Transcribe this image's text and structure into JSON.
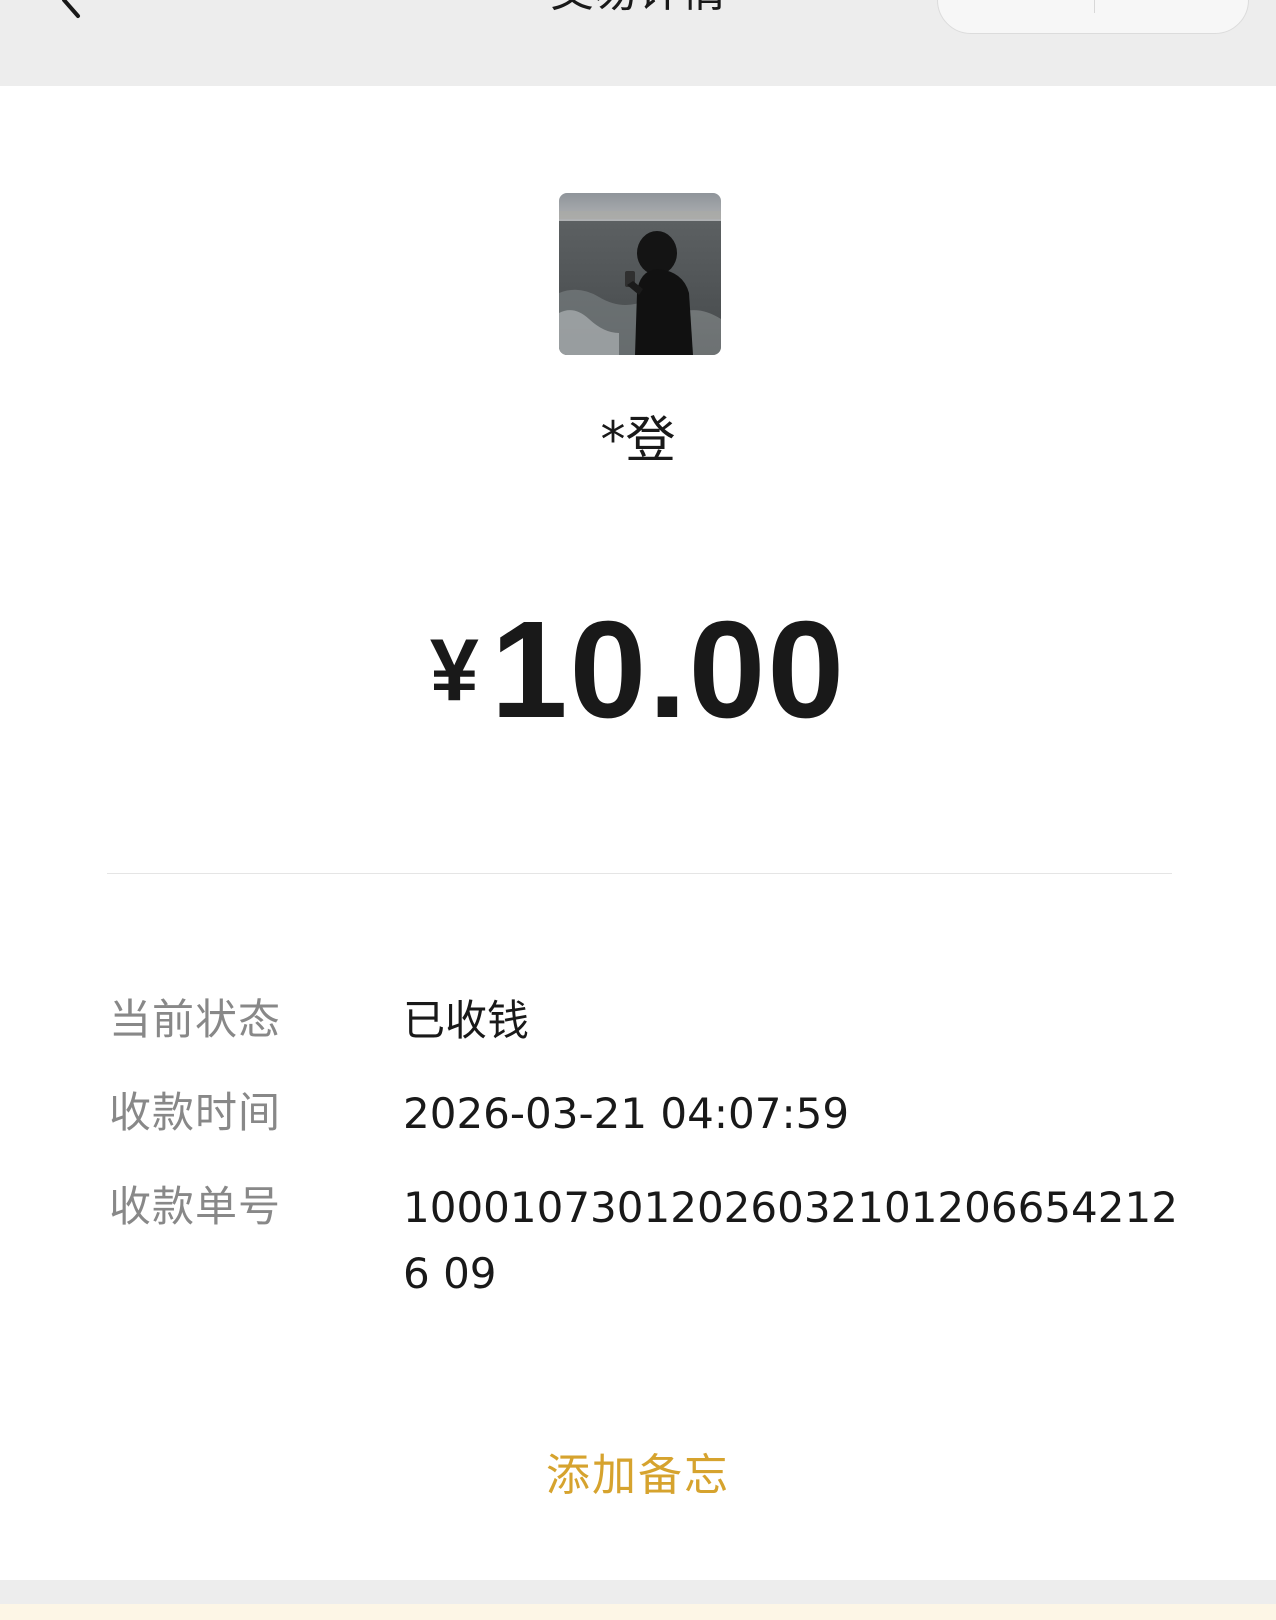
{
  "nav": {
    "title": "交易详情"
  },
  "payer": {
    "name": "*登"
  },
  "amount": {
    "currency": "¥",
    "value": "10.00"
  },
  "details": {
    "status_label": "当前状态",
    "status_value": "已收钱",
    "time_label": "收款时间",
    "time_value": "2026-03-21 04:07:59",
    "order_label": "收款单号",
    "order_value": "100010730120260321012066542126 09"
  },
  "actions": {
    "add_note": "添加备忘"
  },
  "colors": {
    "accent": "#d6a32e",
    "nav_background": "#ededed",
    "label_gray": "#888888"
  }
}
